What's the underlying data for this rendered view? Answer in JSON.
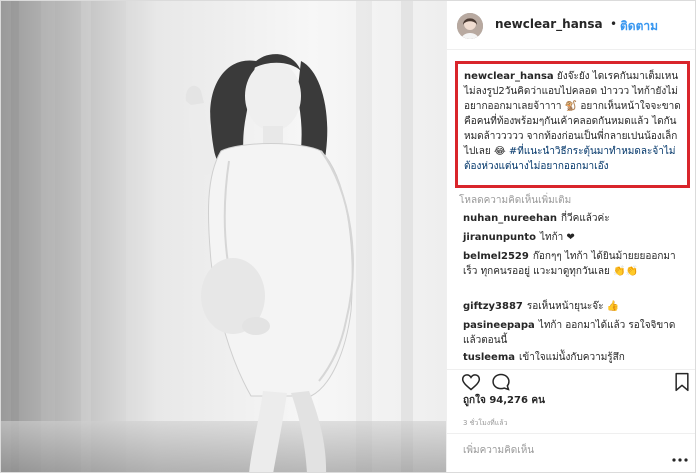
{
  "header": {
    "username": "newclear_hansa",
    "dot": "•",
    "follow_label": "ติดตาม"
  },
  "caption": {
    "username": "newclear_hansa",
    "text_part1": "ยังจ๊ะยัง ไดเรคกันมาเต็มเหนไม่ลงรูป2วันคิดว่าแอบไปคลอด ป่าววว ไทก้ายังไม่อยากออกมาเลยจ้าาาา",
    "emoji1": "🐒",
    "text_part2": "อยากเห็นหน้าใจจะขาด คือคนที่ท้องพร้อมๆกันเค้าคลอดกันหมดแล้ว ไดกันหมดล้าววววว จากท้องก่อนเป็นพี่กลายเปนน้องเล็กไปเลย",
    "emoji2": "😂",
    "hashtag": "#ที่แนะนำวิธีกระตุ้นมาทำหมดละจ้าไม่ต้องห่วงแต่นางไม่อยากออกมาเอ๊ง"
  },
  "load_more_label": "โหลดความคิดเห็นเพิ่มเติม",
  "comments": [
    {
      "user": "nuhan_nureehan",
      "text": "กี่วีคแล้วค่ะ"
    },
    {
      "user": "jiranunpunto",
      "text": "ไทก้า ❤"
    },
    {
      "user": "belmel2529",
      "text": "ก๊อกๆๆ ไทก้า ได้ยินม้ายยยออกมาเร็ว ทุกคนรออยู่ แวะมาดูทุกวันเลย 👏👏"
    },
    {
      "user": "giftzy3887",
      "text": "รอเห็นหน้ายุนะจ๊ะ 👍"
    },
    {
      "user": "pasineepapa",
      "text": "ไทก้า ออกมาได้แล้ว รอใจจิขาดแล้วตอนนี้"
    },
    {
      "user": "tusleema",
      "text": "เข้าใจแม่น้ังกับความรู้สึก"
    }
  ],
  "likes": {
    "prefix": "ถูกใจ",
    "count": "94,276",
    "suffix": "คน"
  },
  "time_label": "3 ชั่วโมงที่แล้ว",
  "add_comment_placeholder": "เพิ่มความคิดเห็น",
  "icons": {
    "heart": "heart-icon",
    "comment": "comment-icon",
    "bookmark": "bookmark-icon",
    "more": "more-options-icon",
    "avatar": "avatar"
  },
  "colors": {
    "link_blue": "#3897f0",
    "highlight_red": "#d9252b",
    "hashtag": "#003569",
    "muted": "#999999",
    "text": "#262626"
  }
}
